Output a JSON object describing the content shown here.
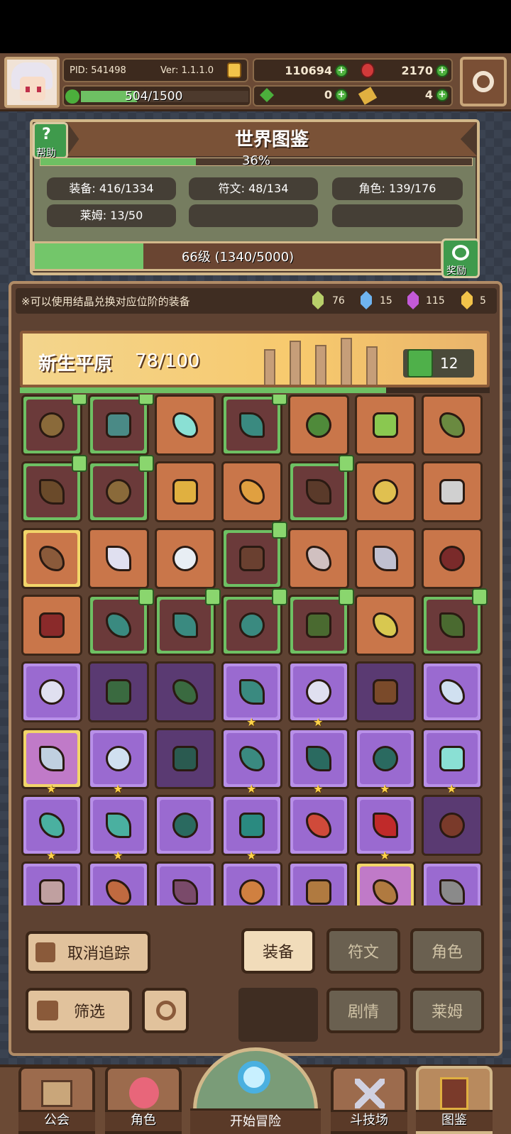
{
  "player": {
    "pid": "PID: 541498",
    "version": "Ver: 1.1.1.0",
    "energy": "504/1500",
    "energy_fraction": 0.336
  },
  "currency": {
    "gold": "110694",
    "gems": "2170",
    "clover": "0",
    "keys": "4"
  },
  "encyclopedia": {
    "title": "世界图鉴",
    "help_label": "帮助",
    "progress_text": "36%",
    "progress": 0.36,
    "stats": [
      "装备: 416/1334",
      "符文: 48/134",
      "角色: 139/176",
      "莱姆: 13/50"
    ],
    "level_text": "66级 (1340/5000)",
    "level_progress": 0.268,
    "reward_label": "奖励"
  },
  "hint": "※可以使用结晶兑换对应位阶的装备",
  "crystals": [
    {
      "color": "#b8cf6a",
      "count": "76"
    },
    {
      "color": "#6fb4f0",
      "count": "15"
    },
    {
      "color": "#c35ad8",
      "count": "115"
    },
    {
      "color": "#f2c34a",
      "count": "5"
    }
  ],
  "region": {
    "name": "新生平原",
    "progress": "78/100",
    "progress_fraction": 0.78,
    "likes": "12"
  },
  "grid_items": [
    {
      "rarity": "green",
      "bg": "#6b3a3a",
      "tracked": true,
      "icon": "hat-icon",
      "color": "#8a6a3a",
      "star": false
    },
    {
      "rarity": "green",
      "bg": "#6b3a3a",
      "tracked": true,
      "icon": "mace-icon",
      "color": "#4a8a86",
      "star": false
    },
    {
      "rarity": "orange",
      "bg": "#c9764a",
      "tracked": false,
      "icon": "orb-icon",
      "color": "#8ae0d4",
      "star": false
    },
    {
      "rarity": "green",
      "bg": "#6b3a3a",
      "tracked": true,
      "icon": "gem-icon",
      "color": "#3a8a80",
      "star": false
    },
    {
      "rarity": "orange",
      "bg": "#c9764a",
      "tracked": false,
      "icon": "hood-icon",
      "color": "#4f8a3a",
      "star": false
    },
    {
      "rarity": "orange",
      "bg": "#c9764a",
      "tracked": false,
      "icon": "armor-icon",
      "color": "#8ac850",
      "star": false
    },
    {
      "rarity": "orange",
      "bg": "#c9764a",
      "tracked": false,
      "icon": "ring-icon",
      "color": "#6a8a40",
      "star": false
    },
    {
      "rarity": "green",
      "bg": "#6b3a3a",
      "tracked": true,
      "icon": "crossbow-icon",
      "color": "#6a4a2a",
      "star": false
    },
    {
      "rarity": "green",
      "bg": "#6b3a3a",
      "tracked": true,
      "icon": "arrow-icon",
      "color": "#8a6a3a",
      "star": false
    },
    {
      "rarity": "orange",
      "bg": "#c9764a",
      "tracked": false,
      "icon": "necklace-icon",
      "color": "#e0b040",
      "star": false
    },
    {
      "rarity": "orange",
      "bg": "#c9764a",
      "tracked": false,
      "icon": "horn-icon",
      "color": "#e0a040",
      "star": false
    },
    {
      "rarity": "green",
      "bg": "#6b3a3a",
      "tracked": true,
      "icon": "belt-icon",
      "color": "#5a3a2a",
      "star": false
    },
    {
      "rarity": "orange",
      "bg": "#c9764a",
      "tracked": false,
      "icon": "ring-icon",
      "color": "#e0c050",
      "star": false
    },
    {
      "rarity": "orange",
      "bg": "#c9764a",
      "tracked": false,
      "icon": "axe-icon",
      "color": "#d0d0d0",
      "star": false
    },
    {
      "rarity": "gold",
      "bg": "#c9764a",
      "tracked": false,
      "icon": "bracelet-icon",
      "color": "#8a5a3a",
      "star": false
    },
    {
      "rarity": "orange",
      "bg": "#c9764a",
      "tracked": false,
      "icon": "pot-icon",
      "color": "#e0e0f0",
      "star": false
    },
    {
      "rarity": "orange",
      "bg": "#c9764a",
      "tracked": false,
      "icon": "pearl-icon",
      "color": "#e8eef4",
      "star": false
    },
    {
      "rarity": "green",
      "bg": "#6b3a3a",
      "tracked": true,
      "icon": "gauntlet-icon",
      "color": "#6a4030",
      "star": false
    },
    {
      "rarity": "orange",
      "bg": "#c9764a",
      "tracked": false,
      "icon": "necklace-icon",
      "color": "#d0c0c0",
      "star": false
    },
    {
      "rarity": "orange",
      "bg": "#c9764a",
      "tracked": false,
      "icon": "sword-icon",
      "color": "#c0c0d0",
      "star": false
    },
    {
      "rarity": "orange",
      "bg": "#c9764a",
      "tracked": false,
      "icon": "helmet-icon",
      "color": "#7a2a2a",
      "star": false
    },
    {
      "rarity": "orange",
      "bg": "#c9764a",
      "tracked": false,
      "icon": "demon-armor-icon",
      "color": "#8a2a2a",
      "star": false
    },
    {
      "rarity": "green",
      "bg": "#6b3a3a",
      "tracked": true,
      "icon": "bow-icon",
      "color": "#3a8a80",
      "star": false
    },
    {
      "rarity": "green",
      "bg": "#6b3a3a",
      "tracked": true,
      "icon": "arrow-icon",
      "color": "#3a8a80",
      "star": false
    },
    {
      "rarity": "green",
      "bg": "#6b3a3a",
      "tracked": true,
      "icon": "boots-icon",
      "color": "#3a8a80",
      "star": false
    },
    {
      "rarity": "green",
      "bg": "#6b3a3a",
      "tracked": true,
      "icon": "hood-icon",
      "color": "#4a6a30",
      "star": false
    },
    {
      "rarity": "orange",
      "bg": "#c9764a",
      "tracked": false,
      "icon": "scroll-icon",
      "color": "#d8c850",
      "star": false
    },
    {
      "rarity": "green",
      "bg": "#6b3a3a",
      "tracked": true,
      "icon": "mask-icon",
      "color": "#4a6a30",
      "star": false
    },
    {
      "rarity": "purple",
      "bg": "#9a6ad0",
      "tracked": false,
      "icon": "sword-icon",
      "color": "#e0e0f0",
      "star": false
    },
    {
      "rarity": "purple-dark",
      "bg": "#5a3a72",
      "tracked": false,
      "icon": "hood-icon",
      "color": "#3a6a40",
      "star": false
    },
    {
      "rarity": "purple-dark",
      "bg": "#5a3a72",
      "tracked": false,
      "icon": "armor-icon",
      "color": "#3a6a40",
      "star": false
    },
    {
      "rarity": "purple",
      "bg": "#9a6ad0",
      "tracked": false,
      "icon": "bow-icon",
      "color": "#3a8a80",
      "star": true
    },
    {
      "rarity": "purple",
      "bg": "#9a6ad0",
      "tracked": false,
      "icon": "arrow-icon",
      "color": "#e0e0f0",
      "star": true
    },
    {
      "rarity": "purple-dark",
      "bg": "#5a3a72",
      "tracked": false,
      "icon": "boots-icon",
      "color": "#7a4a2a",
      "star": false
    },
    {
      "rarity": "purple",
      "bg": "#9a6ad0",
      "tracked": false,
      "icon": "armor-icon",
      "color": "#d0e0f0",
      "star": false
    },
    {
      "rarity": "gold",
      "bg": "#c07ac8",
      "tracked": false,
      "icon": "bracelet-icon",
      "color": "#c0d0e0",
      "star": true
    },
    {
      "rarity": "purple",
      "bg": "#9a6ad0",
      "tracked": false,
      "icon": "boots-icon",
      "color": "#d0e0f0",
      "star": true
    },
    {
      "rarity": "purple-dark",
      "bg": "#5a3a72",
      "tracked": false,
      "icon": "mace-icon",
      "color": "#2a5a50",
      "star": false
    },
    {
      "rarity": "purple",
      "bg": "#9a6ad0",
      "tracked": false,
      "icon": "hat-icon",
      "color": "#3a8a80",
      "star": true
    },
    {
      "rarity": "purple",
      "bg": "#9a6ad0",
      "tracked": false,
      "icon": "armor-icon",
      "color": "#2a6a60",
      "star": true
    },
    {
      "rarity": "purple",
      "bg": "#9a6ad0",
      "tracked": false,
      "icon": "gauntlet-icon",
      "color": "#2a6a60",
      "star": true
    },
    {
      "rarity": "purple",
      "bg": "#9a6ad0",
      "tracked": false,
      "icon": "ring-icon",
      "color": "#8ae0d4",
      "star": true
    },
    {
      "rarity": "purple",
      "bg": "#9a6ad0",
      "tracked": false,
      "icon": "boots-icon",
      "color": "#4ab0a0",
      "star": true
    },
    {
      "rarity": "purple",
      "bg": "#9a6ad0",
      "tracked": false,
      "icon": "gem-icon",
      "color": "#4ab0a0",
      "star": true
    },
    {
      "rarity": "purple",
      "bg": "#9a6ad0",
      "tracked": false,
      "icon": "necklace-icon",
      "color": "#2a6a60",
      "star": false
    },
    {
      "rarity": "purple",
      "bg": "#9a6ad0",
      "tracked": false,
      "icon": "ring-icon",
      "color": "#2a8a80",
      "star": true
    },
    {
      "rarity": "purple",
      "bg": "#9a6ad0",
      "tracked": false,
      "icon": "slime-mask-icon",
      "color": "#d04a3a",
      "star": false
    },
    {
      "rarity": "purple",
      "bg": "#9a6ad0",
      "tracked": false,
      "icon": "cape-icon",
      "color": "#c02a2a",
      "star": true
    },
    {
      "rarity": "purple-dark",
      "bg": "#5a3a72",
      "tracked": false,
      "icon": "boots-icon",
      "color": "#7a3a2a",
      "star": false
    },
    {
      "rarity": "purple",
      "bg": "#9a6ad0",
      "tracked": false,
      "icon": "horned-helm-icon",
      "color": "#c0a0a0",
      "star": false
    },
    {
      "rarity": "purple",
      "bg": "#9a6ad0",
      "tracked": false,
      "icon": "hat-icon",
      "color": "#c06a40",
      "star": false
    },
    {
      "rarity": "purple",
      "bg": "#9a6ad0",
      "tracked": false,
      "icon": "necklace-icon",
      "color": "#7a4a6a",
      "star": false
    },
    {
      "rarity": "purple",
      "bg": "#9a6ad0",
      "tracked": false,
      "icon": "staff-icon",
      "color": "#d08040",
      "star": false
    },
    {
      "rarity": "purple",
      "bg": "#9a6ad0",
      "tracked": false,
      "icon": "horned-helm-icon",
      "color": "#b07a40",
      "star": false
    },
    {
      "rarity": "gold",
      "bg": "#c07ac8",
      "tracked": false,
      "icon": "helmet-icon",
      "color": "#b07a40",
      "star": false
    },
    {
      "rarity": "purple",
      "bg": "#9a6ad0",
      "tracked": false,
      "icon": "axe-icon",
      "color": "#8a8a8a",
      "star": false
    }
  ],
  "controls": {
    "untrack": "取消追踪",
    "filter": "筛选",
    "tabs": [
      "装备",
      "符文",
      "角色"
    ],
    "tabs2": [
      "剧情",
      "莱姆"
    ]
  },
  "nav": {
    "guild": "公会",
    "character": "角色",
    "adventure": "开始冒险",
    "arena": "斗技场",
    "encyclopedia": "图鉴"
  }
}
